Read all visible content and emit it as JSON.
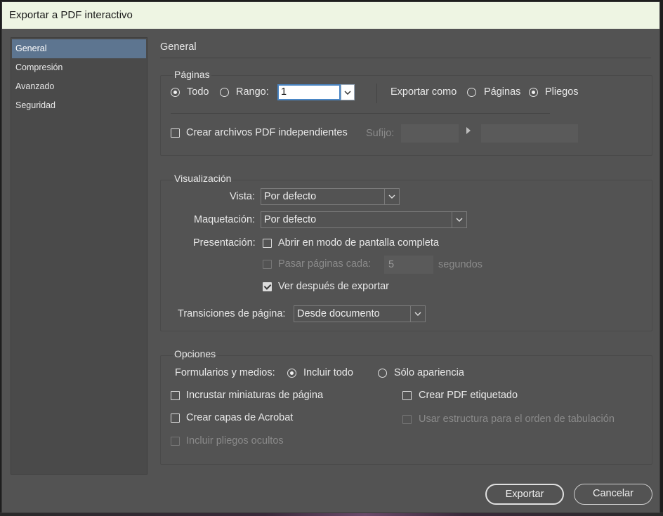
{
  "window": {
    "title": "Exportar a PDF interactivo"
  },
  "sidebar": {
    "items": [
      {
        "label": "General",
        "active": true
      },
      {
        "label": "Compresión",
        "active": false
      },
      {
        "label": "Avanzado",
        "active": false
      },
      {
        "label": "Seguridad",
        "active": false
      }
    ]
  },
  "main": {
    "title": "General",
    "pages": {
      "legend": "Páginas",
      "all_label": "Todo",
      "range_label": "Rango:",
      "range_value": "1",
      "selected": "Todo",
      "export_as_label": "Exportar como",
      "export_pages_label": "Páginas",
      "export_spreads_label": "Pliegos",
      "export_selected": "Pliegos",
      "separate_files_label": "Crear archivos PDF independientes",
      "separate_files_checked": false,
      "suffix_label": "Sufijo:"
    },
    "view": {
      "legend": "Visualización",
      "view_label": "Vista:",
      "view_value": "Por defecto",
      "layout_label": "Maquetación:",
      "layout_value": "Por defecto",
      "presentation_label": "Presentación:",
      "fullscreen_label": "Abrir en modo de pantalla completa",
      "fullscreen_checked": false,
      "flip_label": "Pasar páginas cada:",
      "flip_value": "5",
      "flip_unit": "segundos",
      "flip_enabled": false,
      "view_after_label": "Ver después de exportar",
      "view_after_checked": true,
      "transitions_label": "Transiciones de página:",
      "transitions_value": "Desde documento"
    },
    "options": {
      "legend": "Opciones",
      "forms_label": "Formularios y medios:",
      "include_all_label": "Incluir todo",
      "appearance_only_label": "Sólo apariencia",
      "forms_selected": "Incluir todo",
      "thumbnails_label": "Incrustar miniaturas de página",
      "thumbnails_checked": false,
      "layers_label": "Crear capas de Acrobat",
      "layers_checked": false,
      "hidden_spreads_label": "Incluir pliegos ocultos",
      "hidden_spreads_enabled": false,
      "tagged_label": "Crear PDF etiquetado",
      "tagged_checked": false,
      "tab_order_label": "Usar estructura para el orden de tabulación",
      "tab_order_enabled": false
    }
  },
  "footer": {
    "export_label": "Exportar",
    "cancel_label": "Cancelar"
  },
  "colors": {
    "dialog_bg": "#535353",
    "title_bg": "#eef5e3",
    "selection": "#5d7590",
    "focus": "#4a86c5"
  }
}
